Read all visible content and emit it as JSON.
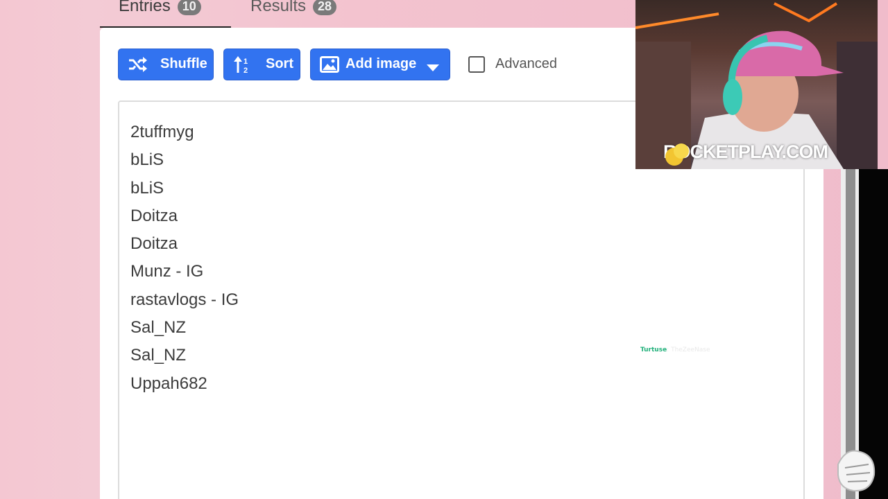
{
  "tabs": {
    "entries": {
      "label": "Entries",
      "count": "10"
    },
    "results": {
      "label": "Results",
      "count": "28"
    }
  },
  "toolbar": {
    "shuffle_label": "Shuffle",
    "sort_label": "Sort",
    "add_image_label": "Add image",
    "advanced_label": "Advanced",
    "advanced_checked": false
  },
  "entries": [
    "2tuffmyg",
    "bLiS",
    "bLiS",
    "Doitza",
    "Doitza",
    "Munz - IG",
    "rastavlogs - IG",
    "Sal_NZ",
    "Sal_NZ",
    "Uppah682"
  ],
  "overlay": {
    "brand": "ROCKETPLAY.COM",
    "chat_user": "Turtuse",
    "chat_text": ": TheZeeNase"
  },
  "colors": {
    "button_blue": "#3273f0",
    "background_pink": "#f3c6d1",
    "badge_gray": "#7a7a7a"
  },
  "icons": {
    "shuffle": "shuffle-icon",
    "sort": "sort-icon",
    "add_image": "image-icon",
    "dropdown": "chevron-down-icon"
  }
}
